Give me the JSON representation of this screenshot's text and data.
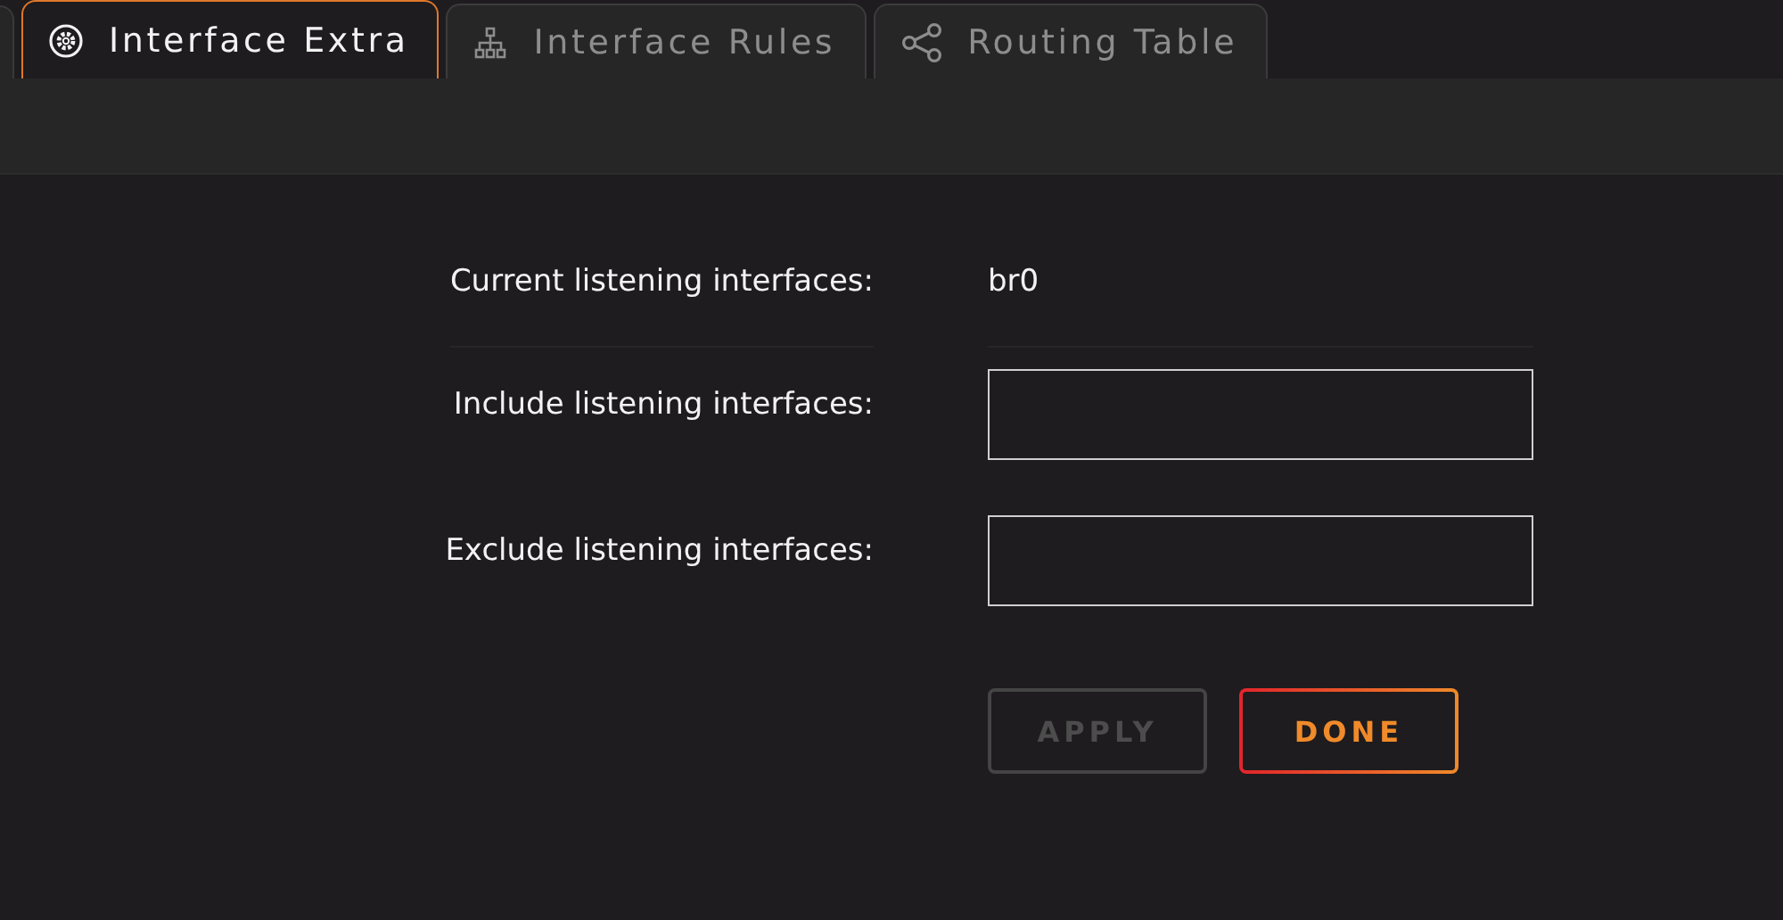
{
  "tabs": [
    {
      "label": "Interface Extra",
      "kind": "gear",
      "selected": true
    },
    {
      "label": "Interface Rules",
      "kind": "tree",
      "selected": false
    },
    {
      "label": "Routing Table",
      "kind": "share",
      "selected": false
    }
  ],
  "form": {
    "current": {
      "label": "Current listening interfaces:",
      "value": "br0"
    },
    "fields": [
      {
        "label": "Include listening interfaces:"
      },
      {
        "label": "Exclude listening interfaces:"
      }
    ],
    "buttons": [
      {
        "label": "APPLY",
        "kind": "plain",
        "disabled": true
      },
      {
        "label": "DONE",
        "kind": "primary",
        "disabled": false
      }
    ]
  }
}
